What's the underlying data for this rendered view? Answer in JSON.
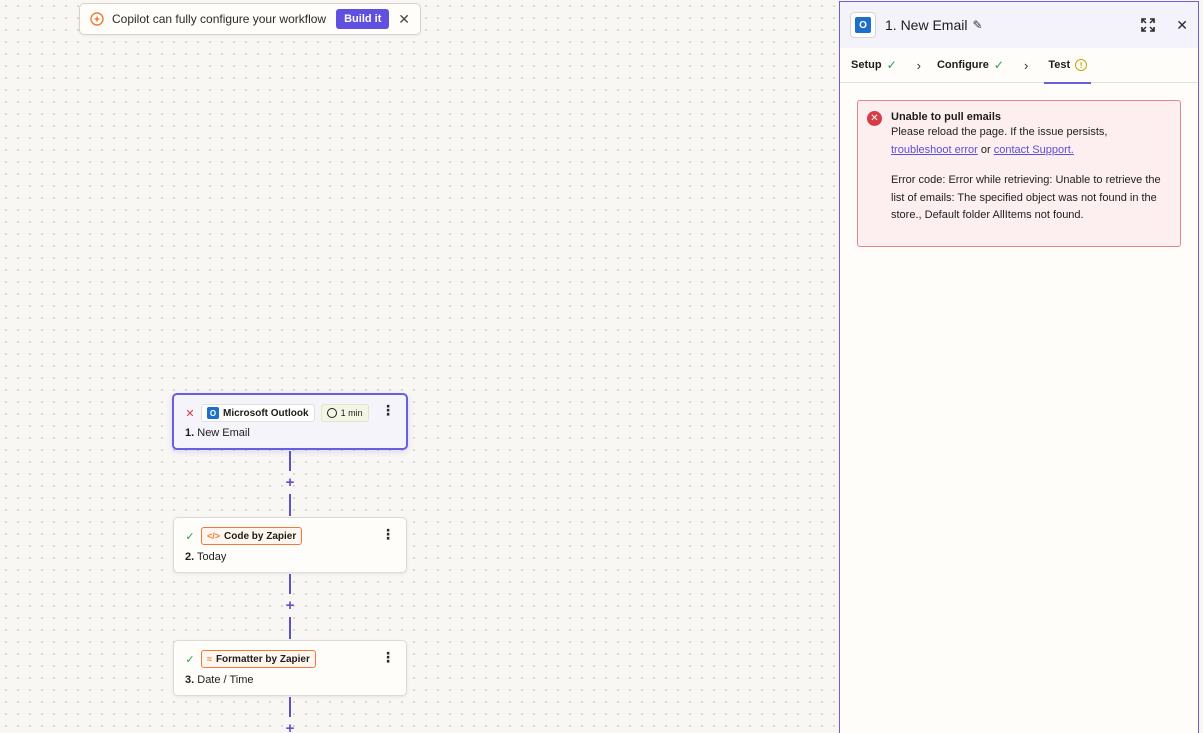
{
  "banner": {
    "text": "Copilot can fully configure your workflow",
    "build_label": "Build it",
    "close": "✕"
  },
  "nodes": [
    {
      "status": "✕",
      "app": "Microsoft Outlook",
      "time": "1 min",
      "step": "1.",
      "title": "New Email"
    },
    {
      "status": "✓",
      "app": "Code by Zapier",
      "app_icon": "</>",
      "step": "2.",
      "title": "Today"
    },
    {
      "status": "✓",
      "app": "Formatter by Zapier",
      "app_icon": "≈",
      "step": "3.",
      "title": "Date / Time"
    }
  ],
  "panel": {
    "title": "1. New Email",
    "tabs": [
      {
        "label": "Setup"
      },
      {
        "label": "Configure"
      },
      {
        "label": "Test"
      }
    ],
    "error": {
      "title": "Unable to pull emails",
      "line1": "Please reload the page. If the issue persists,",
      "link1": "troubleshoot error",
      "or": "or",
      "link2": "contact Support.",
      "code": "Error code: Error while retrieving: Unable to retrieve the list of emails: The specified object was not found in the store., Default folder AllItems not found."
    }
  },
  "colors": {
    "accent": "#6a5ee0",
    "error": "#d43d44",
    "success": "#2d9a4e",
    "orange": "#f07a3b"
  },
  "icons": [
    "copilot-spark-icon",
    "close-icon",
    "outlook-icon",
    "clock-icon",
    "code-icon",
    "formatter-icon",
    "kebab-menu-icon",
    "plus-icon",
    "pencil-icon",
    "expand-icon",
    "check-icon",
    "chevron-right-icon",
    "warning-icon",
    "error-icon"
  ]
}
